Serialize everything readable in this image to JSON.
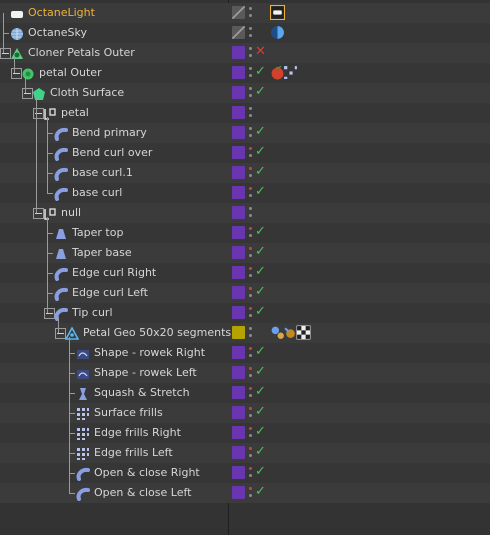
{
  "panel": "object-manager",
  "colors": {
    "selected_text": "#f0b237",
    "layer_purple": "#6a35b0",
    "layer_yellow": "#b4a300",
    "check_green": "#4dc454",
    "cross_red": "#dd3a3a",
    "dot_red": "#dd3a3a",
    "dot_grey": "#8c8c8c"
  },
  "objects": [
    {
      "name": "OctaneLight",
      "icon": "octane-light-icon",
      "selected": true,
      "layer": "gray",
      "dots": [
        "grey",
        "grey"
      ],
      "status": "none",
      "tags": [
        "octane-light-tag-icon"
      ]
    },
    {
      "name": "OctaneSky",
      "icon": "octane-sky-icon",
      "selected": false,
      "layer": "gray",
      "dots": [
        "grey",
        "grey"
      ],
      "status": "none",
      "tags": [
        "octane-environment-tag-icon"
      ]
    },
    {
      "name": "Cloner Petals Outer",
      "icon": "cloner-icon",
      "selected": false,
      "layer": "purple",
      "dots": [
        "grey",
        "grey"
      ],
      "status": "cross",
      "tags": []
    },
    {
      "name": "petal Outer",
      "icon": "mograph-object-icon",
      "selected": false,
      "layer": "purple",
      "dots": [
        "grey",
        "grey"
      ],
      "status": "check",
      "tags": [
        "material-tag-icon",
        "polygon-selection-tag-icon"
      ]
    },
    {
      "name": "Cloth Surface",
      "icon": "cloth-surface-icon",
      "selected": false,
      "layer": "purple",
      "dots": [
        "grey",
        "grey"
      ],
      "status": "check",
      "tags": []
    },
    {
      "name": "petal",
      "icon": "null-icon",
      "selected": false,
      "layer": "purple",
      "dots": [
        "grey",
        "grey"
      ],
      "status": "none",
      "tags": []
    },
    {
      "name": "Bend primary",
      "icon": "bend-deformer-icon",
      "selected": false,
      "layer": "purple",
      "dots": [
        "grey",
        "grey"
      ],
      "status": "check",
      "tags": []
    },
    {
      "name": "Bend curl over",
      "icon": "bend-deformer-icon",
      "selected": false,
      "layer": "purple",
      "dots": [
        "red",
        "grey"
      ],
      "status": "check",
      "tags": []
    },
    {
      "name": "base curl.1",
      "icon": "bend-deformer-icon",
      "selected": false,
      "layer": "purple",
      "dots": [
        "red",
        "grey"
      ],
      "status": "check",
      "tags": []
    },
    {
      "name": "base curl",
      "icon": "bend-deformer-icon",
      "selected": false,
      "layer": "purple",
      "dots": [
        "red",
        "grey"
      ],
      "status": "check",
      "tags": []
    },
    {
      "name": "null",
      "icon": "null-icon",
      "selected": false,
      "layer": "purple",
      "dots": [
        "grey",
        "grey"
      ],
      "status": "none",
      "tags": []
    },
    {
      "name": "Taper top",
      "icon": "taper-deformer-icon",
      "selected": false,
      "layer": "purple",
      "dots": [
        "red",
        "grey"
      ],
      "status": "check",
      "tags": []
    },
    {
      "name": "Taper base",
      "icon": "taper-deformer-icon",
      "selected": false,
      "layer": "purple",
      "dots": [
        "red",
        "grey"
      ],
      "status": "check",
      "tags": []
    },
    {
      "name": "Edge curl Right",
      "icon": "bend-deformer-icon",
      "selected": false,
      "layer": "purple",
      "dots": [
        "red",
        "grey"
      ],
      "status": "check",
      "tags": []
    },
    {
      "name": "Edge curl Left",
      "icon": "bend-deformer-icon",
      "selected": false,
      "layer": "purple",
      "dots": [
        "red",
        "grey"
      ],
      "status": "check",
      "tags": []
    },
    {
      "name": "Tip curl",
      "icon": "bend-deformer-icon",
      "selected": false,
      "layer": "purple",
      "dots": [
        "red",
        "grey"
      ],
      "status": "check",
      "tags": []
    },
    {
      "name": "Petal Geo 50x20 segments",
      "icon": "polygon-object-icon",
      "selected": false,
      "layer": "yellow",
      "dots": [
        "grey",
        "grey"
      ],
      "status": "none",
      "tags": [
        "phong-tag-icon",
        "vertex-map-tag-icon",
        "checker-material-tag-icon"
      ]
    },
    {
      "name": "Shape - rowek Right",
      "icon": "vertex-map-icon",
      "selected": false,
      "layer": "purple",
      "dots": [
        "red",
        "grey"
      ],
      "status": "check",
      "tags": []
    },
    {
      "name": "Shape - rowek Left",
      "icon": "vertex-map-icon",
      "selected": false,
      "layer": "purple",
      "dots": [
        "red",
        "grey"
      ],
      "status": "check",
      "tags": []
    },
    {
      "name": "Squash & Stretch",
      "icon": "squash-stretch-icon",
      "selected": false,
      "layer": "purple",
      "dots": [
        "red",
        "grey"
      ],
      "status": "check",
      "tags": []
    },
    {
      "name": "Surface frills",
      "icon": "displacer-icon",
      "selected": false,
      "layer": "purple",
      "dots": [
        "red",
        "grey"
      ],
      "status": "check",
      "tags": []
    },
    {
      "name": "Edge frills Right",
      "icon": "displacer-icon",
      "selected": false,
      "layer": "purple",
      "dots": [
        "red",
        "grey"
      ],
      "status": "check",
      "tags": []
    },
    {
      "name": "Edge frills Left",
      "icon": "displacer-icon",
      "selected": false,
      "layer": "purple",
      "dots": [
        "red",
        "grey"
      ],
      "status": "check",
      "tags": []
    },
    {
      "name": "Open & close Right",
      "icon": "bend-deformer-icon",
      "selected": false,
      "layer": "purple",
      "dots": [
        "red",
        "grey"
      ],
      "status": "check",
      "tags": []
    },
    {
      "name": "Open & close Left",
      "icon": "bend-deformer-icon",
      "selected": false,
      "layer": "purple",
      "dots": [
        "red",
        "grey"
      ],
      "status": "check",
      "tags": []
    }
  ]
}
